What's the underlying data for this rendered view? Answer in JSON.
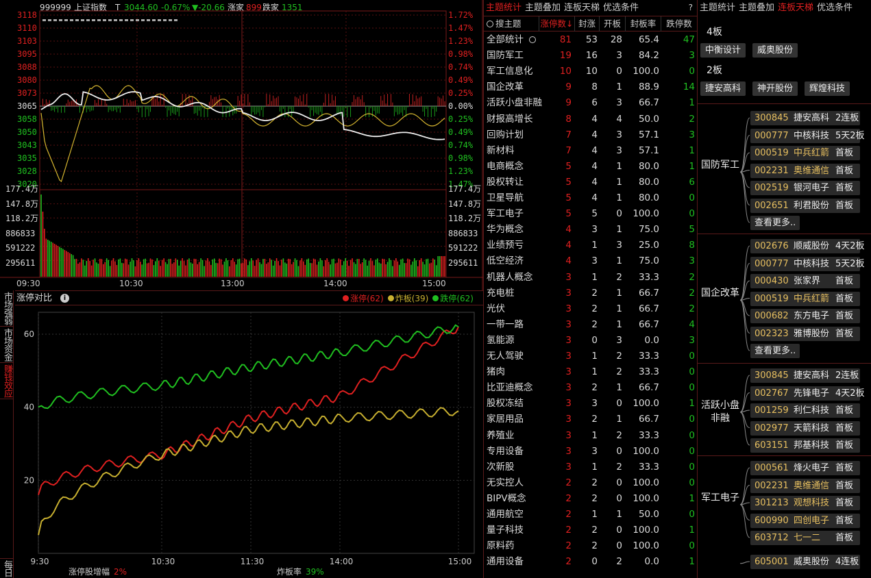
{
  "header": {
    "code": "999999",
    "name": "上证指数",
    "t_label": "T",
    "price": "3044.60",
    "pct": "-0.67%",
    "chg": "▼-20.66",
    "up_label": "涨家",
    "up_count": "899",
    "down_label": "跌家",
    "down_count": "1351"
  },
  "price_axis": {
    "left": [
      "3118",
      "3110",
      "3103",
      "3095",
      "3088",
      "3080",
      "3073",
      "3065",
      "3058",
      "3050",
      "3043",
      "3035",
      "3028",
      "3020"
    ],
    "right": [
      "1.72%",
      "1.47%",
      "1.23%",
      "0.98%",
      "0.74%",
      "0.49%",
      "0.25%",
      "0.00%",
      "0.25%",
      "0.49%",
      "0.74%",
      "0.98%",
      "1.23%",
      "1.47%"
    ]
  },
  "vol_axis": [
    "177.4万",
    "147.8万",
    "118.2万",
    "886833",
    "591222",
    "295611"
  ],
  "time_axis": [
    "09:30",
    "10:30",
    "13:00",
    "14:00",
    "15:00"
  ],
  "sidetabs": [
    "市场强弱",
    "市场资金",
    "赚钱效应",
    "每日"
  ],
  "compare": {
    "title": "涨停对比",
    "legend": [
      {
        "label": "涨停(62)",
        "color": "#e02020"
      },
      {
        "label": "炸板(39)",
        "color": "#c8b030"
      },
      {
        "label": "跌停(62)",
        "color": "#20c020"
      }
    ],
    "yticks": [
      "60",
      "40",
      "20"
    ],
    "xticks": [
      "9:30",
      "10:30",
      "11:30",
      "14:00",
      "15:00"
    ],
    "bottom1_label": "涨停股增幅",
    "bottom1_value": "2%",
    "bottom2_label": "炸板率",
    "bottom2_value": "39%"
  },
  "chart_data": {
    "type": "line",
    "x": [
      "9:30",
      "10:30",
      "11:30",
      "14:00",
      "15:00"
    ],
    "ylim": [
      0,
      66
    ],
    "series": [
      {
        "name": "涨停",
        "color": "#e02020",
        "values": [
          16,
          27,
          37,
          43,
          62
        ]
      },
      {
        "name": "炸板",
        "color": "#c8b030",
        "values": [
          4,
          27,
          34,
          37,
          39
        ]
      },
      {
        "name": "跌停",
        "color": "#20c020",
        "values": [
          39,
          46,
          51,
          55,
          62
        ]
      }
    ]
  },
  "mid_tabs": [
    "主题统计",
    "主题叠加",
    "连板天梯",
    "优选条件"
  ],
  "mid_help": "?",
  "table": {
    "search": "搜主题",
    "headers": [
      "涨停数↓",
      "封涨",
      "开板",
      "封板率",
      "跌停数"
    ],
    "rows": [
      [
        "全部统计",
        "81",
        "53",
        "28",
        "65.4",
        "47"
      ],
      [
        "国防军工",
        "19",
        "16",
        "3",
        "84.2",
        "3"
      ],
      [
        "军工信息化",
        "10",
        "10",
        "0",
        "100.0",
        "0"
      ],
      [
        "国企改革",
        "9",
        "8",
        "1",
        "88.9",
        "14"
      ],
      [
        "活跃小盘非融",
        "9",
        "6",
        "3",
        "66.7",
        "1"
      ],
      [
        "财报高增长",
        "8",
        "4",
        "4",
        "50.0",
        "2"
      ],
      [
        "回购计划",
        "7",
        "4",
        "3",
        "57.1",
        "3"
      ],
      [
        "新材料",
        "7",
        "4",
        "3",
        "57.1",
        "1"
      ],
      [
        "电商概念",
        "5",
        "4",
        "1",
        "80.0",
        "1"
      ],
      [
        "股权转让",
        "5",
        "4",
        "1",
        "80.0",
        "6"
      ],
      [
        "卫星导航",
        "5",
        "4",
        "1",
        "80.0",
        "0"
      ],
      [
        "军工电子",
        "5",
        "5",
        "0",
        "100.0",
        "0"
      ],
      [
        "华为概念",
        "4",
        "3",
        "1",
        "75.0",
        "5"
      ],
      [
        "业绩预亏",
        "4",
        "1",
        "3",
        "25.0",
        "8"
      ],
      [
        "低空经济",
        "4",
        "3",
        "1",
        "75.0",
        "3"
      ],
      [
        "机器人概念",
        "3",
        "1",
        "2",
        "33.3",
        "2"
      ],
      [
        "充电桩",
        "3",
        "2",
        "1",
        "66.7",
        "2"
      ],
      [
        "光伏",
        "3",
        "2",
        "1",
        "66.7",
        "2"
      ],
      [
        "一带一路",
        "3",
        "2",
        "1",
        "66.7",
        "4"
      ],
      [
        "氢能源",
        "3",
        "0",
        "3",
        "0.0",
        "3"
      ],
      [
        "无人驾驶",
        "3",
        "1",
        "2",
        "33.3",
        "0"
      ],
      [
        "猪肉",
        "3",
        "1",
        "2",
        "33.3",
        "0"
      ],
      [
        "比亚迪概念",
        "3",
        "2",
        "1",
        "66.7",
        "0"
      ],
      [
        "股权冻结",
        "3",
        "3",
        "0",
        "100.0",
        "1"
      ],
      [
        "家居用品",
        "3",
        "2",
        "1",
        "66.7",
        "0"
      ],
      [
        "养殖业",
        "3",
        "1",
        "2",
        "33.3",
        "0"
      ],
      [
        "专用设备",
        "3",
        "3",
        "0",
        "100.0",
        "0"
      ],
      [
        "次新股",
        "3",
        "1",
        "2",
        "33.3",
        "0"
      ],
      [
        "无实控人",
        "2",
        "2",
        "0",
        "100.0",
        "0"
      ],
      [
        "BIPV概念",
        "2",
        "2",
        "0",
        "100.0",
        "1"
      ],
      [
        "通用航空",
        "2",
        "1",
        "1",
        "50.0",
        "0"
      ],
      [
        "量子科技",
        "2",
        "2",
        "0",
        "100.0",
        "1"
      ],
      [
        "原料药",
        "2",
        "2",
        "0",
        "100.0",
        "0"
      ],
      [
        "通用设备",
        "2",
        "0",
        "2",
        "0.0",
        "1"
      ]
    ]
  },
  "right_tabs": [
    "主题统计",
    "主题叠加",
    "连板天梯",
    "优选条件"
  ],
  "ladder": [
    {
      "level": "4板",
      "stocks": [
        "中衡设计",
        "威奥股份"
      ]
    },
    {
      "level": "2板",
      "stocks": [
        "捷安高科",
        "神开股份",
        "辉煌科技"
      ]
    }
  ],
  "groups": [
    {
      "name": "国防军工",
      "stocks": [
        [
          "300845",
          "捷安高科",
          "2连板",
          "w"
        ],
        [
          "000777",
          "中核科技",
          "5天2板",
          "w"
        ],
        [
          "000519",
          "中兵红箭",
          "首板",
          "y"
        ],
        [
          "002231",
          "奥维通信",
          "首板",
          "y"
        ],
        [
          "002519",
          "银河电子",
          "首板",
          "w"
        ],
        [
          "002651",
          "利君股份",
          "首板",
          "w"
        ]
      ],
      "more": "查看更多.."
    },
    {
      "name": "国企改革",
      "stocks": [
        [
          "002676",
          "顺威股份",
          "4天2板",
          "w"
        ],
        [
          "000777",
          "中核科技",
          "5天2板",
          "w"
        ],
        [
          "000430",
          "张家界",
          "首板",
          "w"
        ],
        [
          "000519",
          "中兵红箭",
          "首板",
          "y"
        ],
        [
          "000682",
          "东方电子",
          "首板",
          "w"
        ],
        [
          "002323",
          "雅博股份",
          "首板",
          "w"
        ]
      ],
      "more": "查看更多.."
    },
    {
      "name": "活跃小盘非融",
      "stocks": [
        [
          "300845",
          "捷安高科",
          "2连板",
          "w"
        ],
        [
          "002767",
          "先锋电子",
          "4天2板",
          "w"
        ],
        [
          "001259",
          "利仁科技",
          "首板",
          "w"
        ],
        [
          "002977",
          "天箭科技",
          "首板",
          "w"
        ],
        [
          "603151",
          "邦基科技",
          "首板",
          "w"
        ]
      ]
    },
    {
      "name": "军工电子",
      "stocks": [
        [
          "000561",
          "烽火电子",
          "首板",
          "w"
        ],
        [
          "002231",
          "奥维通信",
          "首板",
          "y"
        ],
        [
          "301213",
          "观想科技",
          "首板",
          "y"
        ],
        [
          "600990",
          "四创电子",
          "首板",
          "y"
        ],
        [
          "603712",
          "七一二",
          "首板",
          "y"
        ]
      ]
    },
    {
      "name": "",
      "stocks": [
        [
          "605001",
          "威奥股份",
          "4连板",
          "w"
        ]
      ]
    }
  ]
}
